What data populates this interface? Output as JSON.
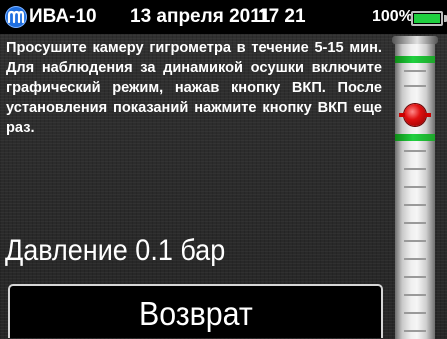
{
  "status_bar": {
    "device_name": "ИВА-10",
    "date": "13 апреля 2011",
    "time": "17 21",
    "battery_percent": "100%",
    "battery_level": 1.0,
    "logo_icon": "device-logo-icon",
    "battery_icon": "battery-icon",
    "accent_color": "#20d040",
    "logo_color": "#1f6fe0"
  },
  "instruction": {
    "text": "Просушите камеру гигрометра в течение 5-15 мин. Для наблюдения за динамикой осушки включите графический режим, нажав кнопку ВКП. После установления показаний нажмите кнопку ВКП еще раз."
  },
  "pressure": {
    "text": "Давление 0.1 бар"
  },
  "buttons": {
    "back_label": "Возврат"
  },
  "gauge": {
    "marker_icon": "red-indicator-icon",
    "band_color": "#20d040",
    "marker_color": "#e01010"
  }
}
